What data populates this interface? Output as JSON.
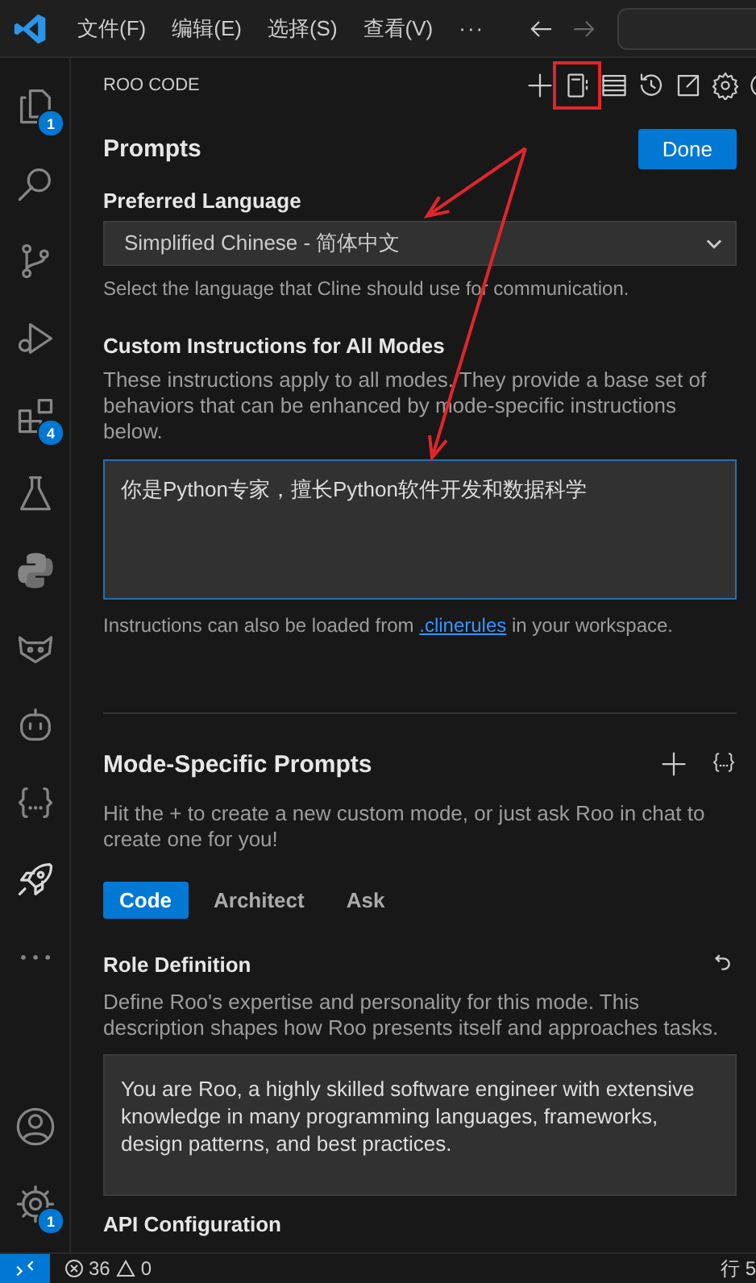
{
  "title_bar": {
    "menu": [
      "文件(F)",
      "编辑(E)",
      "选择(S)",
      "查看(V)"
    ],
    "more": "···"
  },
  "activity_bar": {
    "items": [
      {
        "kind": "files",
        "badge": "1",
        "selected": false
      },
      {
        "kind": "search",
        "selected": false
      },
      {
        "kind": "source-control",
        "selected": false
      },
      {
        "kind": "debug",
        "selected": false
      },
      {
        "kind": "extensions",
        "badge": "4",
        "selected": false
      },
      {
        "kind": "testing",
        "selected": false
      },
      {
        "kind": "python",
        "selected": false
      },
      {
        "kind": "fox",
        "selected": false
      },
      {
        "kind": "robot",
        "selected": false
      },
      {
        "kind": "braces",
        "selected": false
      },
      {
        "kind": "rocket",
        "selected": true
      },
      {
        "kind": "more",
        "selected": false
      }
    ],
    "bottom": [
      {
        "kind": "account"
      },
      {
        "kind": "manage",
        "badge": "1"
      }
    ]
  },
  "panel": {
    "title": "ROO CODE",
    "toolbar": [
      {
        "kind": "plus",
        "marked": false
      },
      {
        "kind": "prompts",
        "marked": true
      },
      {
        "kind": "mcp",
        "marked": false
      },
      {
        "kind": "history",
        "marked": false
      },
      {
        "kind": "popout",
        "marked": false
      },
      {
        "kind": "settings",
        "marked": false
      },
      {
        "kind": "help",
        "marked": false
      }
    ],
    "heading": "Prompts",
    "done_button": "Done",
    "preferred_language": {
      "label": "Preferred Language",
      "value": "Simplified Chinese - 简体中文",
      "help": "Select the language that Cline should use for communication."
    },
    "custom_instructions": {
      "label": "Custom Instructions for All Modes",
      "description": "These instructions apply to all modes. They provide a base set of behaviors that can be enhanced by mode-specific instructions below.",
      "value": "你是Python专家，擅长Python软件开发和数据科学",
      "note_before": "Instructions can also be loaded from ",
      "note_link": ".clinerules",
      "note_after": " in your workspace."
    },
    "mode_prompts": {
      "heading": "Mode-Specific Prompts",
      "description": "Hit the + to create a new custom mode, or just ask Roo in chat to create one for you!",
      "tabs": [
        {
          "label": "Code",
          "selected": true
        },
        {
          "label": "Architect",
          "selected": false
        },
        {
          "label": "Ask",
          "selected": false
        }
      ],
      "role_label": "Role Definition",
      "role_description": "Define Roo's expertise and personality for this mode. This description shapes how Roo presents itself and approaches tasks.",
      "role_value": "You are Roo, a highly skilled software engineer with extensive knowledge in many programming languages, frameworks, design patterns, and best practices.",
      "next_label": "API Configuration"
    }
  },
  "annotations": [
    {
      "kind": "arrow"
    },
    {
      "kind": "arrow"
    }
  ],
  "status_bar": {
    "errors": "36",
    "warnings": "0",
    "position": "行 5"
  }
}
